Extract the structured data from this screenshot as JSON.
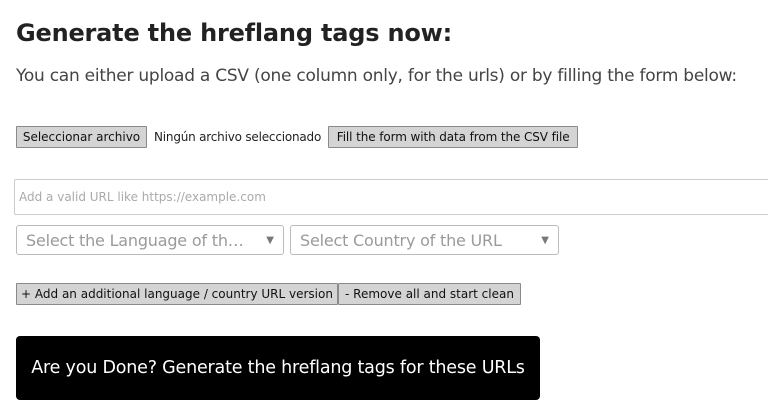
{
  "heading": "Generate the hreflang tags now:",
  "subheading": "You can either upload a CSV (one column only, for the urls) or by filling the form below:",
  "csv_upload": {
    "file_button_label": "Seleccionar archivo",
    "file_status": "Ningún archivo seleccionado",
    "fill_button_label": "Fill the form with data from the CSV file"
  },
  "url_field": {
    "placeholder": "Add a valid URL like https://example.com",
    "value": ""
  },
  "language_select": {
    "placeholder": "Select the Language of th…",
    "caret_icon": "▼"
  },
  "country_select": {
    "placeholder": "Select Country of the URL",
    "caret_icon": "▼"
  },
  "actions": {
    "add_label": "+ Add an additional language / country URL version",
    "remove_label": "- Remove all and start clean"
  },
  "generate_label": "Are you Done? Generate the hreflang tags for these URLs",
  "colors": {
    "primary_button_bg": "#000000",
    "primary_button_text": "#ffffff",
    "secondary_button_bg": "#d4d4d4"
  }
}
